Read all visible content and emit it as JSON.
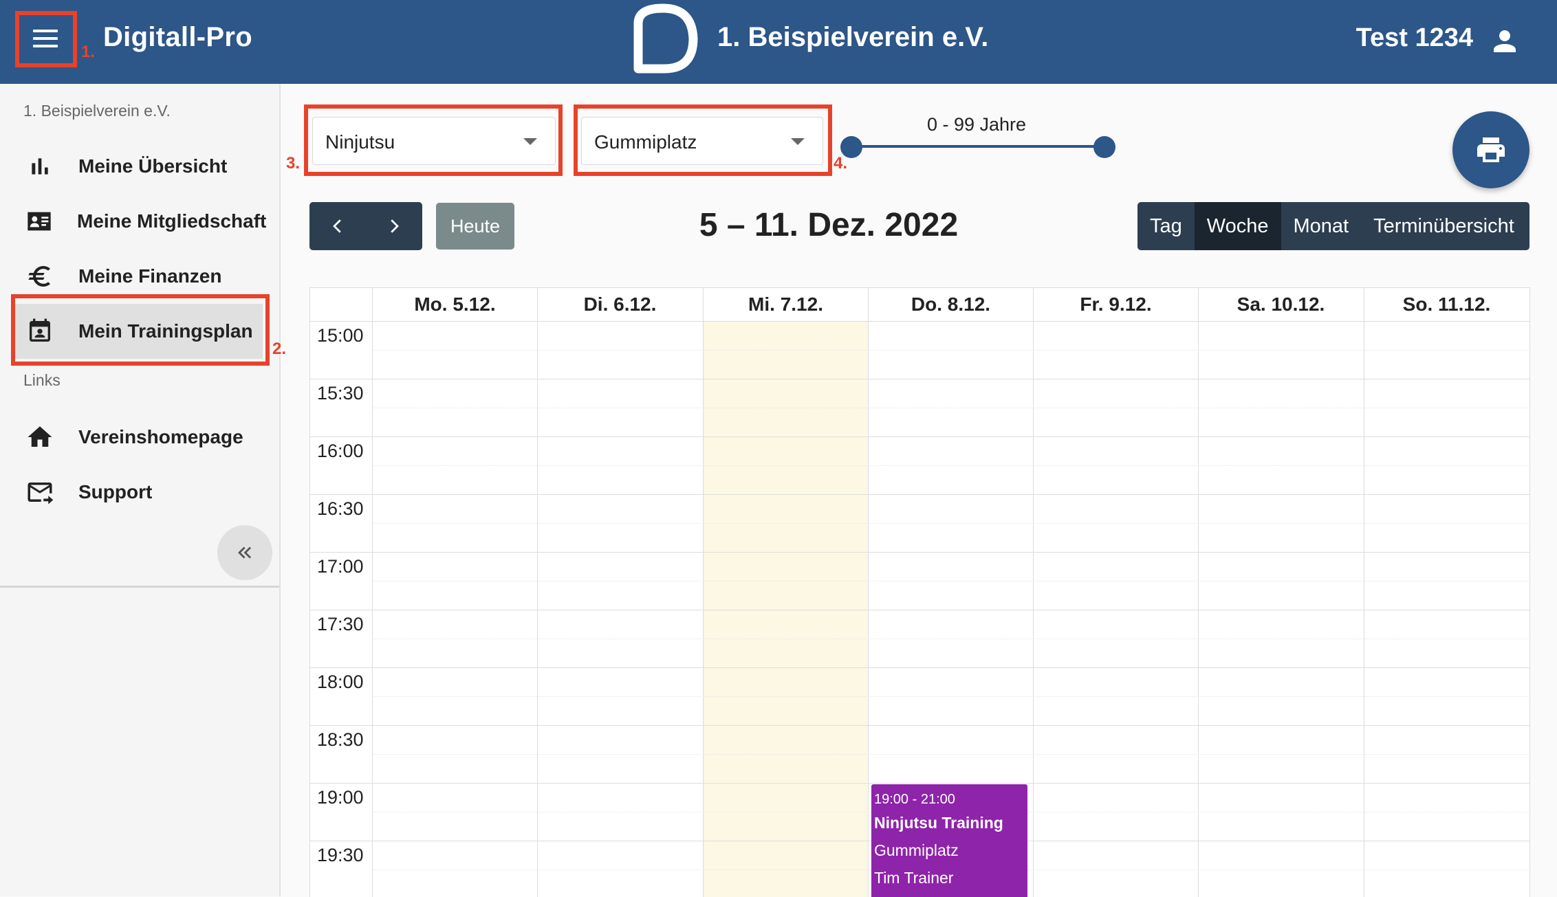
{
  "header": {
    "app_title": "Digitall-Pro",
    "club_name": "1. Beispielverein e.V.",
    "user_name": "Test 1234",
    "icons": [
      "menu-icon",
      "logo",
      "account-icon"
    ]
  },
  "sidebar": {
    "subheader": "1. Beispielverein e.V.",
    "items": [
      {
        "label": "Meine Übersicht",
        "icon": "bar-chart-icon"
      },
      {
        "label": "Meine Mitgliedschaft",
        "icon": "id-card-icon"
      },
      {
        "label": "Meine Finanzen",
        "icon": "euro-icon"
      },
      {
        "label": "Mein Trainingsplan",
        "icon": "calendar-account-icon",
        "active": true
      }
    ],
    "links_header": "Links",
    "links": [
      {
        "label": "Vereinshomepage",
        "icon": "home-icon"
      },
      {
        "label": "Support",
        "icon": "mail-forward-icon"
      }
    ]
  },
  "annotations": [
    "1.",
    "2.",
    "3.",
    "4."
  ],
  "filters": {
    "sport": "Ninjutsu",
    "location": "Gummiplatz",
    "age_range": "0 - 99 Jahre",
    "age_min": 0,
    "age_max": 99
  },
  "toolbar": {
    "today_label": "Heute",
    "range_title": "5 – 11. Dez. 2022",
    "views": [
      "Tag",
      "Woche",
      "Monat",
      "Terminübersicht"
    ],
    "active_view": "Woche"
  },
  "calendar": {
    "days": [
      "Mo. 5.12.",
      "Di. 6.12.",
      "Mi. 7.12.",
      "Do. 8.12.",
      "Fr. 9.12.",
      "Sa. 10.12.",
      "So. 11.12."
    ],
    "today_index": 2,
    "times": [
      "15:00",
      "15:30",
      "16:00",
      "16:30",
      "17:00",
      "17:30",
      "18:00",
      "18:30",
      "19:00",
      "19:30"
    ],
    "events": [
      {
        "time": "19:00 - 21:00",
        "title": "Ninjutsu Training",
        "location": "Gummiplatz",
        "trainer": "Tim Trainer",
        "day": "Do. 8.12.",
        "color": "#8e24aa"
      }
    ]
  },
  "colors": {
    "primary": "#2d5689",
    "dark": "#2c3e50",
    "highlight": "#e8422a",
    "today_bg": "#fcf8e3",
    "event": "#8e24aa"
  }
}
